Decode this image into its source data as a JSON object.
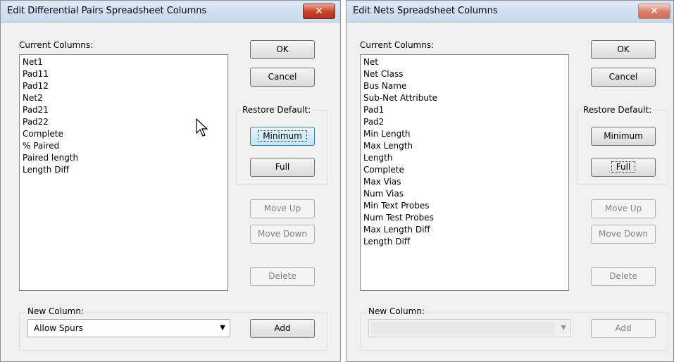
{
  "dialog1": {
    "title": "Edit Differential Pairs Spreadsheet Columns",
    "close_label": "✕",
    "current_columns_label": "Current Columns:",
    "columns": [
      "Net1",
      "Pad11",
      "Pad12",
      "Net2",
      "Pad21",
      "Pad22",
      "Complete",
      "% Paired",
      "Paired length",
      "Length Diff"
    ],
    "ok_label": "OK",
    "cancel_label": "Cancel",
    "restore_default_label": "Restore Default:",
    "minimum_label": "Minimum",
    "full_label": "Full",
    "move_up_label": "Move Up",
    "move_down_label": "Move Down",
    "delete_label": "Delete",
    "new_column_label": "New Column:",
    "new_column_value": "Allow Spurs",
    "add_label": "Add"
  },
  "dialog2": {
    "title": "Edit Nets Spreadsheet Columns",
    "close_label": "✕",
    "current_columns_label": "Current Columns:",
    "columns": [
      "Net",
      "Net Class",
      "Bus Name",
      "Sub-Net Attribute",
      "Pad1",
      "Pad2",
      "Min Length",
      "Max Length",
      "Length",
      "Complete",
      "Max Vias",
      "Num Vias",
      "Min Text Probes",
      "Num Test Probes",
      "Max Length Diff",
      "Length Diff"
    ],
    "ok_label": "OK",
    "cancel_label": "Cancel",
    "restore_default_label": "Restore Default:",
    "minimum_label": "Minimum",
    "full_label": "Full",
    "move_up_label": "Move Up",
    "move_down_label": "Move Down",
    "delete_label": "Delete",
    "new_column_label": "New Column:",
    "new_column_value": "",
    "add_label": "Add"
  }
}
